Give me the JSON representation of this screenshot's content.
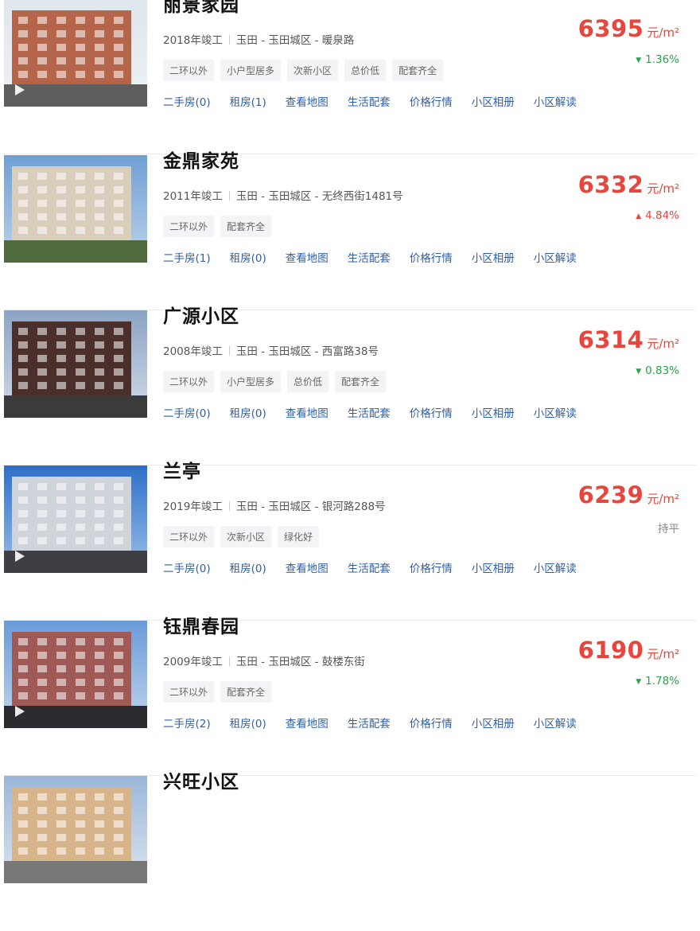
{
  "unit": "元/m²",
  "link_labels": [
    "二手房",
    "租房",
    "查看地图",
    "生活配套",
    "价格行情",
    "小区相册",
    "小区解读"
  ],
  "items": [
    {
      "name": "丽景家园",
      "year": "2018年竣工",
      "location": "玉田 - 玉田城区 - 暖泉路",
      "tags": [
        "二环以外",
        "小户型居多",
        "次新小区",
        "总价低",
        "配套齐全"
      ],
      "links": [
        "二手房(0)",
        "租房(1)",
        "查看地图",
        "生活配套",
        "价格行情",
        "小区相册",
        "小区解读"
      ],
      "price": "6395",
      "change": "1.36%",
      "trend": "down",
      "has_video": true
    },
    {
      "name": "金鼎家苑",
      "year": "2011年竣工",
      "location": "玉田 - 玉田城区 - 无终西街1481号",
      "tags": [
        "二环以外",
        "配套齐全"
      ],
      "links": [
        "二手房(1)",
        "租房(0)",
        "查看地图",
        "生活配套",
        "价格行情",
        "小区相册",
        "小区解读"
      ],
      "price": "6332",
      "change": "4.84%",
      "trend": "up",
      "has_video": false
    },
    {
      "name": "广源小区",
      "year": "2008年竣工",
      "location": "玉田 - 玉田城区 - 西富路38号",
      "tags": [
        "二环以外",
        "小户型居多",
        "总价低",
        "配套齐全"
      ],
      "links": [
        "二手房(0)",
        "租房(0)",
        "查看地图",
        "生活配套",
        "价格行情",
        "小区相册",
        "小区解读"
      ],
      "price": "6314",
      "change": "0.83%",
      "trend": "down",
      "has_video": false
    },
    {
      "name": "兰亭",
      "year": "2019年竣工",
      "location": "玉田 - 玉田城区 - 银河路288号",
      "tags": [
        "二环以外",
        "次新小区",
        "绿化好"
      ],
      "links": [
        "二手房(0)",
        "租房(0)",
        "查看地图",
        "生活配套",
        "价格行情",
        "小区相册",
        "小区解读"
      ],
      "price": "6239",
      "change": "持平",
      "trend": "flat",
      "has_video": true
    },
    {
      "name": "钰鼎春园",
      "year": "2009年竣工",
      "location": "玉田 - 玉田城区 - 鼓楼东街",
      "tags": [
        "二环以外",
        "配套齐全"
      ],
      "links": [
        "二手房(2)",
        "租房(0)",
        "查看地图",
        "生活配套",
        "价格行情",
        "小区相册",
        "小区解读"
      ],
      "price": "6190",
      "change": "1.78%",
      "trend": "down",
      "has_video": true
    },
    {
      "name": "兴旺小区",
      "year": "",
      "location": "",
      "tags": [],
      "links": [],
      "price": "",
      "change": "",
      "trend": "",
      "has_video": false
    }
  ],
  "colors": {
    "price": "#e8453c",
    "down": "#2aa34a",
    "up": "#e8453c",
    "flat": "#888888",
    "link": "#2f5fa8",
    "tag_bg": "#f2f4f6"
  }
}
